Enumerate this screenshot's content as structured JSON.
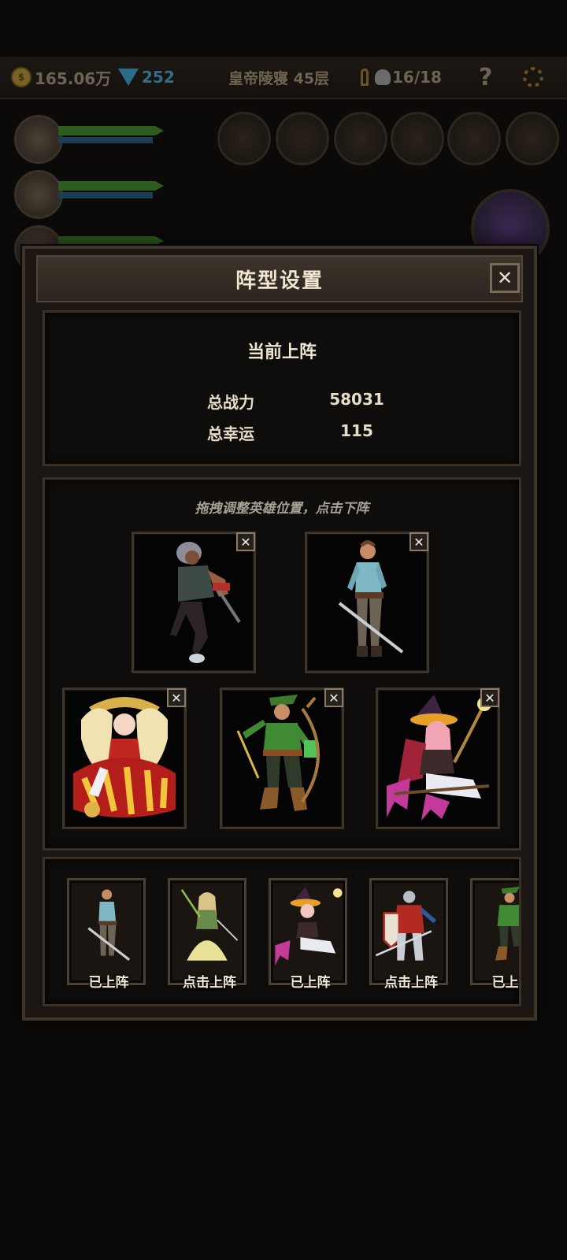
{
  "hud": {
    "gold": "165.06万",
    "diamonds": "252",
    "stage": "皇帝陵寝 45层",
    "kills": "16/18",
    "help": "?",
    "icons": [
      "coin-icon",
      "diamond-icon",
      "key-icon",
      "skull-icon",
      "help-icon",
      "gear-icon"
    ]
  },
  "modal": {
    "title": "阵型设置",
    "close": "✕"
  },
  "stats": {
    "title": "当前上阵",
    "power_label": "总战力",
    "power_value": "58031",
    "luck_label": "总幸运",
    "luck_value": "115"
  },
  "formation": {
    "hint": "拖拽调整英雄位置，点击下阵",
    "remove_label": "✕",
    "slots": [
      {
        "hero": "armored-brawler"
      },
      {
        "hero": "swordsman"
      },
      {
        "hero": "golden-maiden"
      },
      {
        "hero": "green-archer"
      },
      {
        "hero": "pink-witch"
      }
    ]
  },
  "roster": [
    {
      "hero": "swordsman",
      "status": "已上阵"
    },
    {
      "hero": "elf-priestess",
      "status": "点击上阵"
    },
    {
      "hero": "pink-witch",
      "status": "已上阵"
    },
    {
      "hero": "red-knight",
      "status": "点击上阵"
    },
    {
      "hero": "green-archer",
      "status": "已上阵"
    }
  ],
  "colors": {
    "panel_bg": "#0f0d0b",
    "frame": "#3e342a",
    "text": "#e6dcc8",
    "hint": "#a8a095"
  }
}
